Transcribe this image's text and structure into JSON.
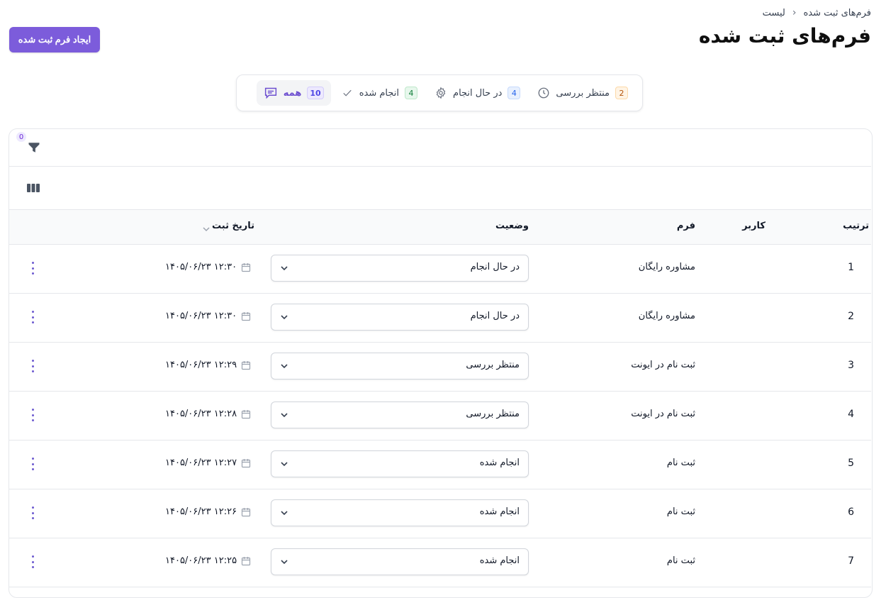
{
  "breadcrumb": {
    "current": "فرم‌های ثبت شده",
    "separator": "›",
    "parent": "لیست"
  },
  "page": {
    "title": "فرم‌های ثبت شده",
    "create_button": "ایجاد فرم ثبت شده"
  },
  "tabs": [
    {
      "label": "منتظر بررسی",
      "count": "2",
      "icon": "clock-icon"
    },
    {
      "label": "در حال انجام",
      "count": "4",
      "icon": "gear-icon"
    },
    {
      "label": "انجام شده",
      "count": "4",
      "icon": "check-icon"
    },
    {
      "label": "همه",
      "count": "10",
      "icon": "chat-icon",
      "active": true
    }
  ],
  "toolbar": {
    "filter_count": "0",
    "filter_icon": "filter-icon",
    "columns_icon": "columns-icon"
  },
  "table": {
    "headers": {
      "order": "ترتیب",
      "user": "کاربر",
      "form": "فرم",
      "status": "وضعیت",
      "date": "تاریخ ثبت"
    },
    "rows": [
      {
        "num": "1",
        "form": "مشاوره رایگان",
        "status": "در حال انجام",
        "date": "۱۴۰۵/۰۶/۲۳ ۱۲:۳۰"
      },
      {
        "num": "2",
        "form": "مشاوره رایگان",
        "status": "در حال انجام",
        "date": "۱۴۰۵/۰۶/۲۳ ۱۲:۳۰"
      },
      {
        "num": "3",
        "form": "ثبت نام در ایونت",
        "status": "منتظر بررسی",
        "date": "۱۴۰۵/۰۶/۲۳ ۱۲:۲۹"
      },
      {
        "num": "4",
        "form": "ثبت نام در ایونت",
        "status": "منتظر بررسی",
        "date": "۱۴۰۵/۰۶/۲۳ ۱۲:۲۸"
      },
      {
        "num": "5",
        "form": "ثبت نام",
        "status": "انجام شده",
        "date": "۱۴۰۵/۰۶/۲۳ ۱۲:۲۷"
      },
      {
        "num": "6",
        "form": "ثبت نام",
        "status": "انجام شده",
        "date": "۱۴۰۵/۰۶/۲۳ ۱۲:۲۶"
      },
      {
        "num": "7",
        "form": "ثبت نام",
        "status": "انجام شده",
        "date": "۱۴۰۵/۰۶/۲۳ ۱۲:۲۵"
      }
    ]
  },
  "colors": {
    "accent": "#7c5cdb",
    "border": "#e5e7eb",
    "header_bg": "#f9fafb"
  }
}
